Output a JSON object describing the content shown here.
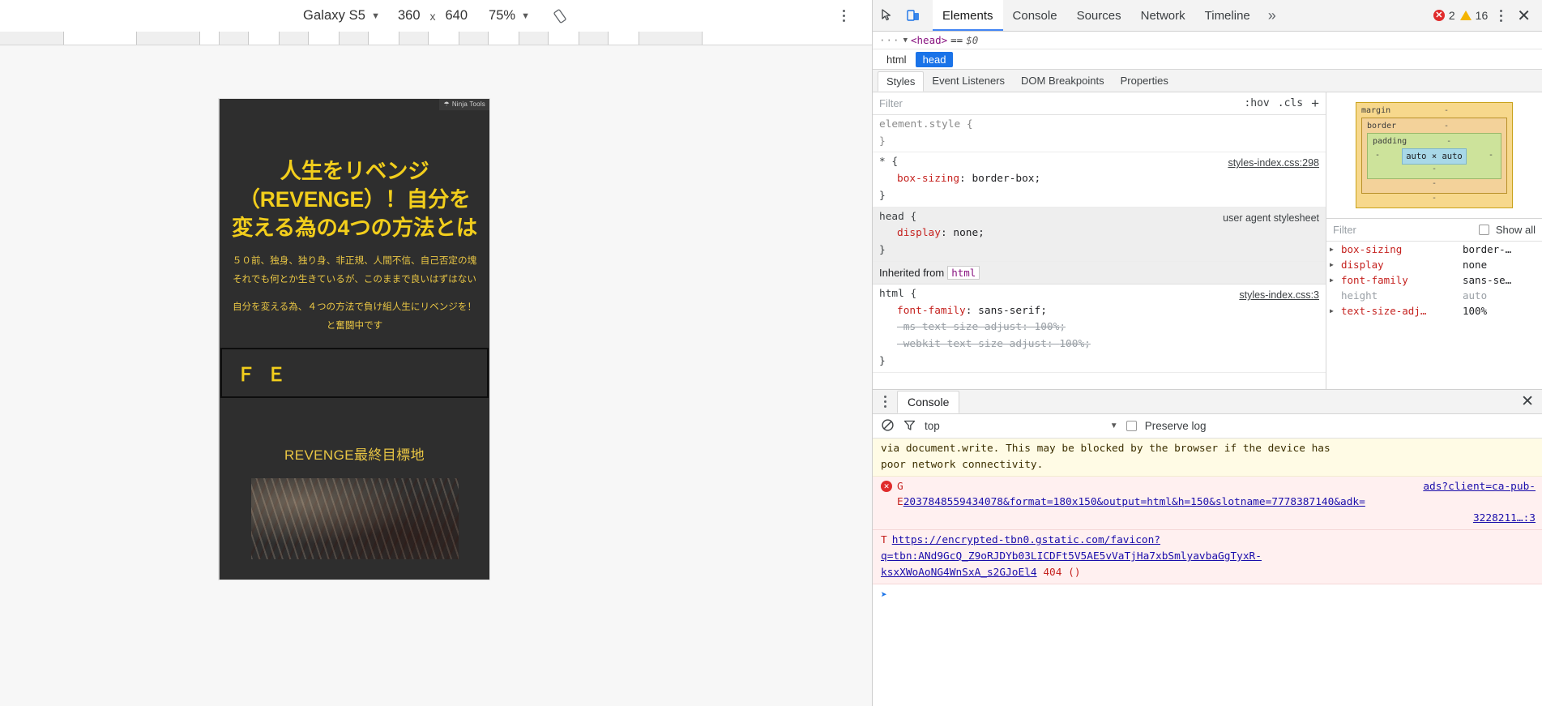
{
  "device_toolbar": {
    "device": "Galaxy S5",
    "width": "360",
    "separator": "x",
    "height": "640",
    "zoom": "75%",
    "caret": "▼",
    "rotate_icon": "rotate-device-icon",
    "menu_icon": "more-options-icon"
  },
  "page": {
    "badge": {
      "icon": "ninja-tools-icon",
      "label": "Ninja Tools"
    },
    "title": "人生をリベンジ（REVENGE）！自分を変える為の4つの方法とは",
    "description_lines": [
      "５０前、独身、独り身、非正規、人間不信、自己否定の塊　それでも何とか生きているが、このままで良いはずはない",
      "自分を変える為、４つの方法で負け組人生にリベンジを！と奮闘中です"
    ],
    "fe_box_text": "Ｆ Ｅ",
    "post_heading": "REVENGE最終目標地",
    "post_image_alt": "rocky-terrain-photo"
  },
  "devtools": {
    "toolbar": {
      "inspect_icon": "inspect-element-icon",
      "device_icon": "toggle-device-toolbar-icon",
      "tabs": [
        {
          "label": "Elements",
          "selected": true
        },
        {
          "label": "Console",
          "selected": false
        },
        {
          "label": "Sources",
          "selected": false
        },
        {
          "label": "Network",
          "selected": false
        },
        {
          "label": "Timeline",
          "selected": false
        }
      ],
      "more_tabs": "»",
      "error_count": "2",
      "warning_count": "16",
      "error_icon": "error-circle-icon",
      "warning_icon": "warning-triangle-icon",
      "menu_icon": "devtools-menu-icon",
      "close_icon": "close-devtools-icon"
    },
    "dom_line": {
      "ellipsis": "···",
      "triangle": "▼",
      "tag": "<head>",
      "equals": "==",
      "variable": "$0"
    },
    "breadcrumb": [
      {
        "label": "html",
        "selected": false
      },
      {
        "label": "head",
        "selected": true
      }
    ],
    "pane_tabs": [
      {
        "label": "Styles",
        "selected": true
      },
      {
        "label": "Event Listeners",
        "selected": false
      },
      {
        "label": "DOM Breakpoints",
        "selected": false
      },
      {
        "label": "Properties",
        "selected": false
      }
    ],
    "styles": {
      "filter_placeholder": "Filter",
      "hov_label": ":hov",
      "cls_label": ".cls",
      "new_rule": "+",
      "rules": [
        {
          "selector": "element.style {",
          "close": "}",
          "source": "",
          "properties": []
        },
        {
          "selector": "* {",
          "close": "}",
          "source": "styles-index.css:298",
          "properties": [
            {
              "name": "box-sizing",
              "value": "border-box;",
              "struck": false
            }
          ]
        },
        {
          "selector": "head {",
          "close": "}",
          "source": "user agent stylesheet",
          "user_agent": true,
          "properties": [
            {
              "name": "display",
              "value": "none;",
              "struck": false
            }
          ]
        }
      ],
      "inherited_label": "Inherited from",
      "inherited_from": "html",
      "inherited_rule": {
        "selector": "html {",
        "close": "}",
        "source": "styles-index.css:3",
        "properties": [
          {
            "name": "font-family",
            "value": "sans-serif;",
            "struck": false
          },
          {
            "name": "-ms-text-size-adjust",
            "value": "100%;",
            "struck": true
          },
          {
            "name": "-webkit-text-size-adjust",
            "value": "100%;",
            "struck": true
          }
        ]
      }
    },
    "box_model": {
      "margin_label": "margin",
      "border_label": "border",
      "padding_label": "padding",
      "content": "auto × auto",
      "dash": "-"
    },
    "computed": {
      "filter_placeholder": "Filter",
      "show_all_label": "Show all",
      "rows": [
        {
          "name": "box-sizing",
          "value": "border-…",
          "dim": false
        },
        {
          "name": "display",
          "value": "none",
          "dim": false
        },
        {
          "name": "font-family",
          "value": "sans-se…",
          "dim": false
        },
        {
          "name": "height",
          "value": "auto",
          "dim": true
        },
        {
          "name": "text-size-adj…",
          "value": "100%",
          "dim": false
        }
      ]
    },
    "drawer": {
      "menu_icon": "drawer-menu-icon",
      "tab": "Console",
      "close_icon": "close-drawer-icon",
      "toolbar": {
        "clear_icon": "clear-console-icon",
        "filter_icon": "filter-icon",
        "context": "top",
        "context_caret": "▼",
        "preserve_log": "Preserve log"
      },
      "messages": [
        {
          "type": "warn",
          "lines": [
            "via document.write. This may be blocked by the browser if the device has",
            "poor network connectivity."
          ]
        },
        {
          "type": "error",
          "icon": "error-circle-icon",
          "prefix": "G",
          "body_left": "E",
          "link_lines": [
            "ads?client=ca-pub-",
            "2037848559434078&format=180x150&output=html&h=150&slotname=7778387140&adk=",
            "3228211…:3"
          ]
        },
        {
          "type": "error",
          "prefix": "T",
          "link_lines": [
            "https://encrypted-tbn0.gstatic.com/favicon?",
            "q=tbn:ANd9GcQ_Z9oRJDYb03LICDFt5V5AE5vVaTjHa7xbSmlyavbaGgTyxR-",
            "ksxXWoAoNG4WnSxA_s2GJoEl4"
          ],
          "status": "404 ()"
        }
      ]
    }
  },
  "colors": {
    "accent_blue": "#4285f4",
    "page_bg": "#2e2e2e",
    "page_text": "#f2ce1c",
    "error_red": "#e02b2b",
    "warning_yellow": "#f4b400"
  }
}
